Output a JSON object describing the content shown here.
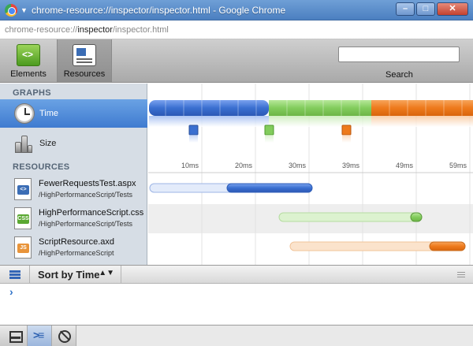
{
  "window": {
    "title": "chrome-resource://inspector/inspector.html - Google Chrome",
    "buttons": [
      "–",
      "□",
      "✕"
    ]
  },
  "url": {
    "prefix": "chrome-resource://",
    "host": "inspector",
    "path": "/inspector.html"
  },
  "toolbar": {
    "elements_label": "Elements",
    "resources_label": "Resources",
    "search_value": "",
    "search_label": "Search"
  },
  "sidebar": {
    "graphs_title": "GRAPHS",
    "graphs": [
      {
        "label": "Time",
        "icon": "clock-icon",
        "selected": true
      },
      {
        "label": "Size",
        "icon": "weights-icon",
        "selected": false
      }
    ],
    "resources_title": "RESOURCES",
    "resources": [
      {
        "name": "FewerRequestsTest.aspx",
        "path": "/HighPerformanceScript/Tests",
        "type": "html",
        "badge": "<>",
        "badge_color": "#3b6db5"
      },
      {
        "name": "HighPerformanceScript.css",
        "path": "/HighPerformanceScript/Tests",
        "type": "css",
        "badge": "CSS",
        "badge_color": "#5aa832"
      },
      {
        "name": "ScriptResource.axd",
        "path": "/HighPerformanceScript",
        "type": "js",
        "badge": "JS",
        "badge_color": "#e8943a"
      }
    ]
  },
  "timeline": {
    "ticks": [
      "10ms",
      "20ms",
      "30ms",
      "39ms",
      "49ms",
      "59ms"
    ],
    "colors": {
      "html": "#3a6fd0",
      "css": "#7ec85a",
      "js": "#ef7a1a"
    }
  },
  "bottom": {
    "sort_label": "Sort by Time",
    "sort_arrows": "▲▼"
  },
  "console": {
    "prompt": "›"
  }
}
